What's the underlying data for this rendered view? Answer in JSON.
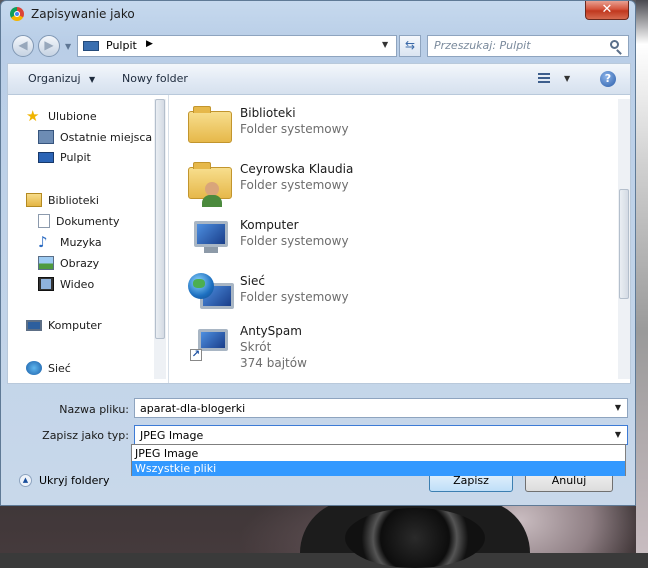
{
  "window": {
    "title": "Zapisywanie jako",
    "close_label": "✕"
  },
  "address": {
    "location": "Pulpit",
    "search_placeholder": "Przeszukaj: Pulpit"
  },
  "commandbar": {
    "organize": "Organizuj",
    "new_folder": "Nowy folder"
  },
  "sidebar": {
    "items": [
      {
        "label": "Ulubione",
        "icon": "star-icon"
      },
      {
        "label": "Ostatnie miejsca",
        "icon": "recent-places-icon"
      },
      {
        "label": "Pulpit",
        "icon": "desktop-icon"
      },
      {
        "label": "Biblioteki",
        "icon": "libraries-icon"
      },
      {
        "label": "Dokumenty",
        "icon": "documents-icon"
      },
      {
        "label": "Muzyka",
        "icon": "music-icon"
      },
      {
        "label": "Obrazy",
        "icon": "pictures-icon"
      },
      {
        "label": "Wideo",
        "icon": "video-icon"
      },
      {
        "label": "Komputer",
        "icon": "computer-icon"
      },
      {
        "label": "Sieć",
        "icon": "network-icon"
      }
    ]
  },
  "files": [
    {
      "name": "Biblioteki",
      "type": "Folder systemowy",
      "size": "",
      "icon": "libraries-folder-icon"
    },
    {
      "name": "Ceyrowska Klaudia",
      "type": "Folder systemowy",
      "size": "",
      "icon": "user-folder-icon"
    },
    {
      "name": "Komputer",
      "type": "Folder systemowy",
      "size": "",
      "icon": "computer-icon"
    },
    {
      "name": "Sieć",
      "type": "Folder systemowy",
      "size": "",
      "icon": "network-icon"
    },
    {
      "name": "AntySpam",
      "type": "Skrót",
      "size": "374 bajtów",
      "icon": "shortcut-icon"
    }
  ],
  "form": {
    "filename_label": "Nazwa pliku:",
    "filename_value": "aparat-dla-blogerki",
    "type_label": "Zapisz jako typ:",
    "type_value": "JPEG Image",
    "type_options": [
      "JPEG Image",
      "Wszystkie pliki"
    ]
  },
  "footer": {
    "hide_folders": "Ukryj foldery",
    "save": "Zapisz",
    "cancel": "Anuluj"
  }
}
